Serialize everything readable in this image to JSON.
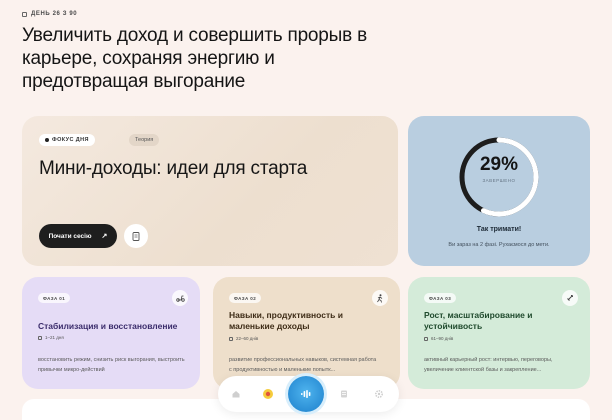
{
  "header": {
    "day_label": "ДЕНЬ 26 З 90",
    "headline": "Увеличить доход и совершить прорыв в карьере, сохраняя энергию и предотвращая выгорание"
  },
  "focus_card": {
    "focus_chip": "ФОКУС ДНЯ",
    "theory_chip": "Теория",
    "title": "Мини-доходы: идеи для старта",
    "start_button": "Почати сесію",
    "arrow_icon": "arrow-up-right-icon",
    "bookmark_icon": "bookmark-icon"
  },
  "progress_card": {
    "percent_label": "29%",
    "percent_value": 0.29,
    "caption": "ЗАВЕРШЕНО",
    "title": "Так тримати!",
    "subtitle": "Ви зараз на 2 фазі. Рухаємося до мети.",
    "ring_color": "#ffffff",
    "track_color": "#1d1d1d"
  },
  "phases": [
    {
      "chip": "ФАЗА 01",
      "title": "Стабилизация и восстановление",
      "days": "1–21 дня",
      "description": "восстановить режим, снизить риск выгорания, выстроить привычки микро-действий",
      "icon": "scooter-icon",
      "color": "#e5dcf6"
    },
    {
      "chip": "ФАЗА 02",
      "title": "Навыки, продуктивность и маленькие доходы",
      "days": "22–60 днів",
      "description": "развитие профессиональных навыков, системная работа с продуктивностью и маленькие попытк...",
      "icon": "runner-icon",
      "color": "#eedfcb"
    },
    {
      "chip": "ФАЗА 03",
      "title": "Рост, масштабирование и устойчивость",
      "days": "61–90 днів",
      "description": "активный карьерный рост: интервью, переговоры, увеличение клиентской базы и закрепление...",
      "icon": "rocket-icon",
      "color": "#d4ebd9"
    }
  ],
  "dock": {
    "items": [
      "home-icon",
      "medal-icon",
      "voice-icon",
      "journal-icon",
      "settings-icon"
    ],
    "accent": "#2b8fd6"
  }
}
